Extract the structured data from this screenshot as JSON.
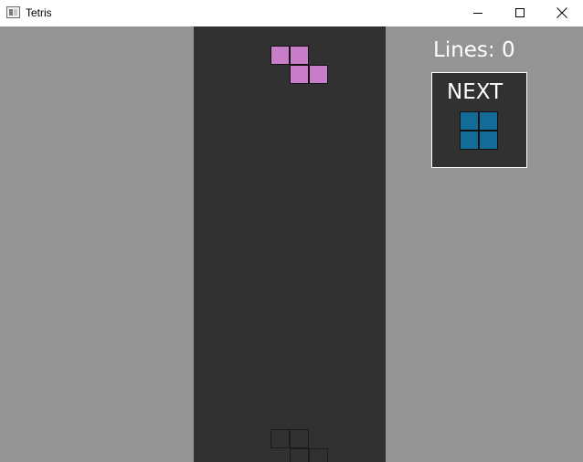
{
  "window": {
    "title": "Tetris",
    "controls": [
      "minimize",
      "maximize",
      "close"
    ]
  },
  "game": {
    "lines_label": "Lines: 0",
    "lines_count": 0,
    "next_label": "NEXT",
    "next_piece": "O",
    "current_piece": "Z"
  },
  "colors": {
    "background": "#949494",
    "board": "#313131",
    "z_piece": "#c87dc8",
    "o_piece": "#136b97",
    "text": "#ffffff"
  }
}
